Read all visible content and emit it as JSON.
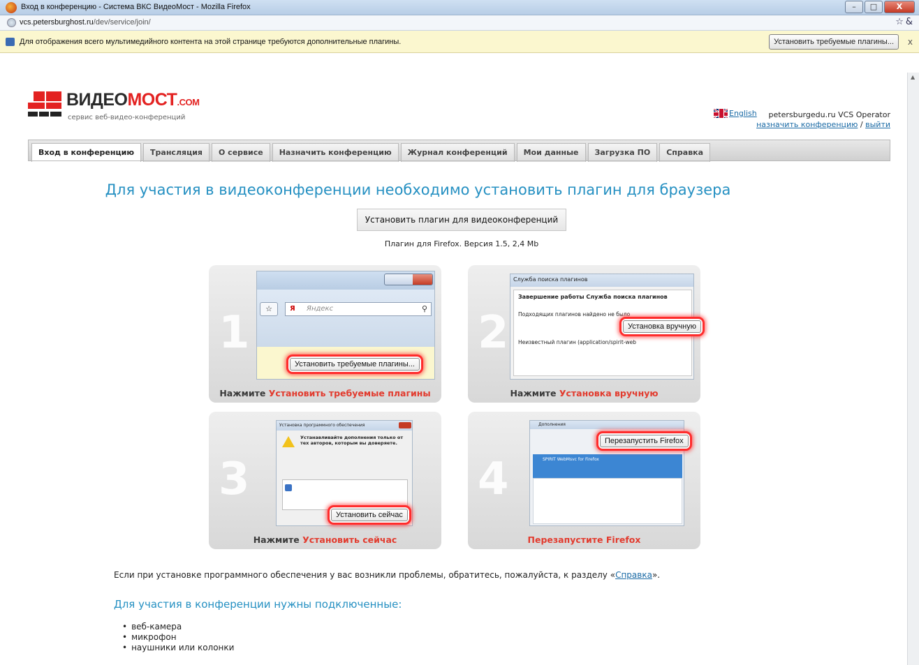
{
  "window": {
    "title": "Вход в конференцию - Система ВКС ВидеоМост - Mozilla Firefox",
    "minimize": "–",
    "maximize": "□",
    "close": "X"
  },
  "addressbar": {
    "url_host": "vcs.petersburghost.ru",
    "url_path": "/dev/service/join/"
  },
  "plugin_bar": {
    "message": "Для отображения всего мультимедийного контента на этой странице требуются дополнительные плагины.",
    "button": "Установить требуемые плагины...",
    "close": "x"
  },
  "header": {
    "logo_dark": "ВИДЕО",
    "logo_red": "МОСТ",
    "logo_com": ".COM",
    "logo_sub": "сервис веб-видео-конференций",
    "lang_link": "English",
    "user_name": "petersburgedu.ru VCS Operator",
    "link_schedule": "назначить конференцию",
    "separator": "/",
    "link_logout": "выйти"
  },
  "tabs": [
    {
      "label": "Вход в конференцию",
      "active": true
    },
    {
      "label": "Трансляция",
      "active": false
    },
    {
      "label": "О сервисе",
      "active": false
    },
    {
      "label": "Назначить конференцию",
      "active": false
    },
    {
      "label": "Журнал конференций",
      "active": false
    },
    {
      "label": "Мои данные",
      "active": false
    },
    {
      "label": "Загрузка ПО",
      "active": false
    },
    {
      "label": "Справка",
      "active": false
    }
  ],
  "main": {
    "heading": "Для участия в видеоконференции необходимо установить плагин для браузера",
    "install_button": "Установить плагин для видеоконференций",
    "version": "Плагин для Firefox. Версия 1.5, 2,4 Mb"
  },
  "steps": [
    {
      "num": "1",
      "prefix": "Нажмите ",
      "highlight": "Установить требуемые плагины",
      "callout": "Установить требуемые плагины...",
      "shot_search": "Яндекс"
    },
    {
      "num": "2",
      "prefix": "Нажмите ",
      "highlight": "Установка вручную",
      "callout": "Установка вручную",
      "shot_title": "Служба поиска плагинов",
      "shot_line1": "Завершение работы Служба поиска плагинов",
      "shot_line2": "Подходящих плагинов найдено не было",
      "shot_line3": "Неизвестный плагин (application/spirit-web"
    },
    {
      "num": "3",
      "prefix": "Нажмите ",
      "highlight": "Установить сейчас",
      "callout": "Установить сейчас",
      "shot_title": "Установка программного обеспечения",
      "shot_warn": "Устанавливайте дополнения только от тех авторов, которым вы доверяете."
    },
    {
      "num": "4",
      "prefix": "",
      "highlight": "Перезапустите Firefox",
      "callout": "Перезапустить Firefox",
      "shot_title": "Дополнения",
      "shot_item": "SPIRIT WebMsvc for Firefox"
    }
  ],
  "footer": {
    "help_prefix": "Если при установке программного обеспечения у вас возникли проблемы, обратитесь, пожалуйста, к разделу «",
    "help_link": "Справка",
    "help_suffix": "».",
    "req_heading": "Для участия в конференции нужны подключенные:",
    "requirements": [
      "веб-камера",
      "микрофон",
      "наушники или колонки"
    ]
  },
  "colors": {
    "accent_blue": "#2590c2",
    "brand_red": "#e32221",
    "callout_red": "#ff2c2c",
    "link": "#1a6aa5"
  },
  "icons": [
    "firefox-icon",
    "globe-icon",
    "star-icon",
    "plugin-icon",
    "uk-flag-icon",
    "warning-icon",
    "puzzle-icon"
  ]
}
